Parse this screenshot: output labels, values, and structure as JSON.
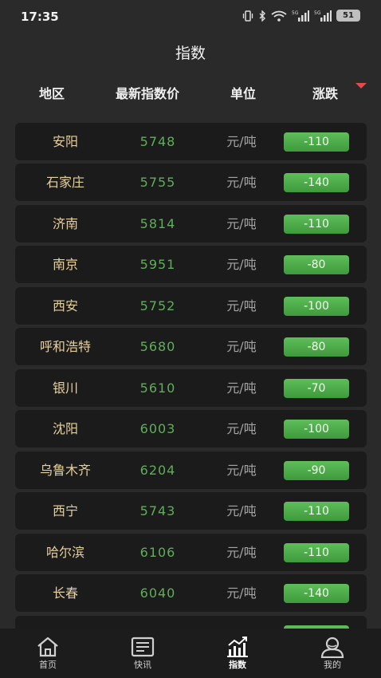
{
  "status_bar": {
    "time": "17:35",
    "battery": "51",
    "network_1": "5G",
    "network_2": "5G"
  },
  "page": {
    "title": "指数"
  },
  "table_header": {
    "region": "地区",
    "price": "最新指数价",
    "unit": "单位",
    "change": "涨跌"
  },
  "rows": [
    {
      "region": "安阳",
      "price": "5748",
      "unit": "元/吨",
      "change": "-110"
    },
    {
      "region": "石家庄",
      "price": "5755",
      "unit": "元/吨",
      "change": "-140"
    },
    {
      "region": "济南",
      "price": "5814",
      "unit": "元/吨",
      "change": "-110"
    },
    {
      "region": "南京",
      "price": "5951",
      "unit": "元/吨",
      "change": "-80"
    },
    {
      "region": "西安",
      "price": "5752",
      "unit": "元/吨",
      "change": "-100"
    },
    {
      "region": "呼和浩特",
      "price": "5680",
      "unit": "元/吨",
      "change": "-80"
    },
    {
      "region": "银川",
      "price": "5610",
      "unit": "元/吨",
      "change": "-70"
    },
    {
      "region": "沈阳",
      "price": "6003",
      "unit": "元/吨",
      "change": "-100"
    },
    {
      "region": "乌鲁木齐",
      "price": "6204",
      "unit": "元/吨",
      "change": "-90"
    },
    {
      "region": "西宁",
      "price": "5743",
      "unit": "元/吨",
      "change": "-110"
    },
    {
      "region": "哈尔滨",
      "price": "6106",
      "unit": "元/吨",
      "change": "-110"
    },
    {
      "region": "长春",
      "price": "6040",
      "unit": "元/吨",
      "change": "-140"
    }
  ],
  "tabs": [
    {
      "label": "首页",
      "icon": "home-icon"
    },
    {
      "label": "快讯",
      "icon": "news-icon"
    },
    {
      "label": "指数",
      "icon": "chart-icon",
      "active": true
    },
    {
      "label": "我的",
      "icon": "profile-icon"
    }
  ],
  "colors": {
    "change_badge": "#4caf50",
    "price_text": "#5fae59",
    "region_text": "#e7cf9e",
    "sort_caret": "#e14b4b"
  }
}
